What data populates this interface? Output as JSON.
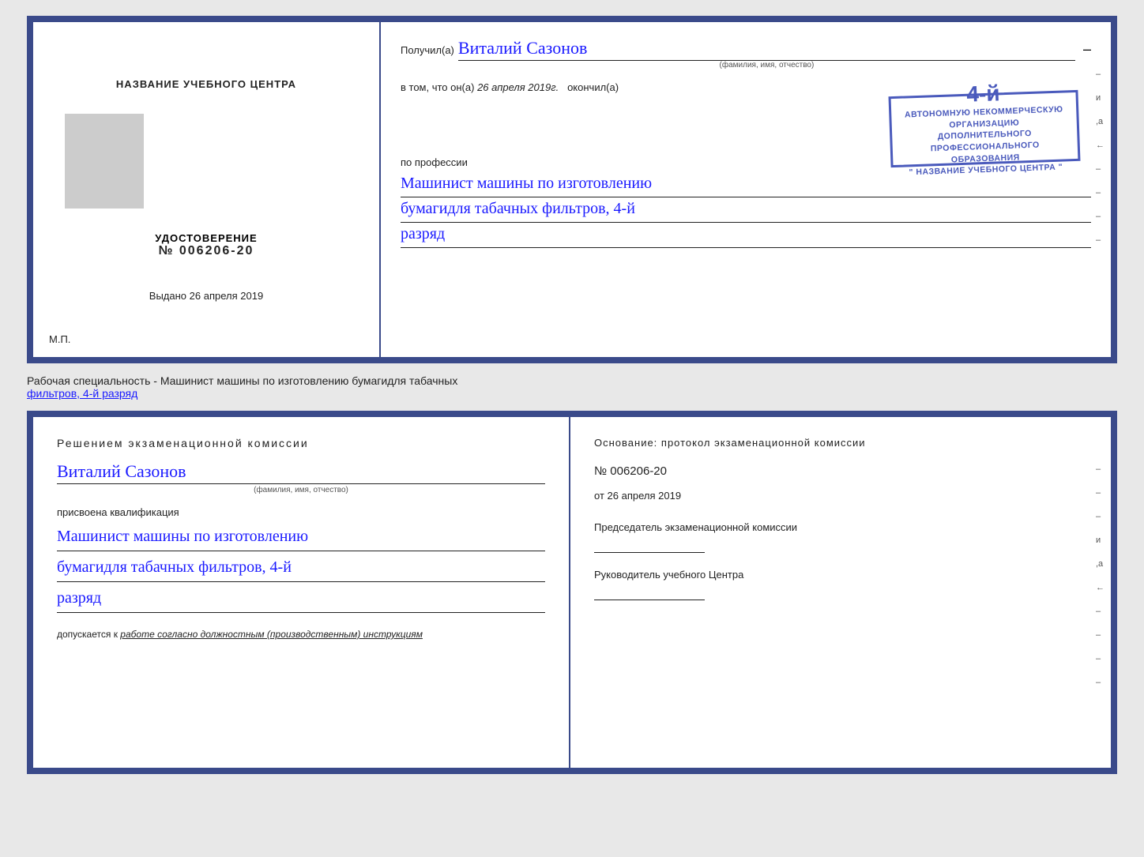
{
  "topCert": {
    "leftTitle": "НАЗВАНИЕ УЧЕБНОГО ЦЕНТРА",
    "certLabel": "УДОСТОВЕРЕНИЕ",
    "certNumber": "№ 006206-20",
    "issuedLabel": "Выдано",
    "issuedDate": "26 апреля 2019",
    "mpLabel": "М.П.",
    "recipientLabel": "Получил(а)",
    "recipientName": "Виталий Сазонов",
    "fioLabel": "(фамилия, имя, отчество)",
    "bodyText1": "в том, что он(а)",
    "dateText": "26 апреля 2019г.",
    "finishedLabel": "окончил(а)",
    "stampBigNum": "4-й",
    "stampLine1": "АВТОНОМНУЮ НЕКОММЕРЧЕСКУЮ ОРГАНИЗАЦИЮ",
    "stampLine2": "ДОПОЛНИТЕЛЬНОГО ПРОФЕССИОНАЛЬНОГО ОБРАЗОВАНИЯ",
    "stampLine3": "\" НАЗВАНИЕ УЧЕБНОГО ЦЕНТРА \"",
    "professionLabel": "по профессии",
    "professionLine1": "Машинист машины по изготовлению",
    "professionLine2": "бумагидля табачных фильтров, 4-й",
    "professionLine3": "разряд",
    "sideMarks": [
      "–",
      "и",
      ",а",
      "←",
      "–",
      "–",
      "–",
      "–"
    ]
  },
  "subtitleText": "Рабочая специальность - Машинист машины по изготовлению бумагидля табачных",
  "subtitleUnderline": "фильтров, 4-й разряд",
  "bottomCert": {
    "decisionTitle": "Решением  экзаменационной  комиссии",
    "personName": "Виталий Сазонов",
    "fioLabel": "(фамилия, имя, отчество)",
    "assignedText": "присвоена квалификация",
    "qualLine1": "Машинист машины по изготовлению",
    "qualLine2": "бумагидля табачных фильтров, 4-й",
    "qualLine3": "разряд",
    "allowedText": "допускается к",
    "allowedValue": "работе согласно должностным (производственным) инструкциям",
    "basisLabel": "Основание: протокол  экзаменационной  комиссии",
    "protocolNum": "№  006206-20",
    "dateFrom": "от",
    "dateFromValue": "26 апреля 2019",
    "chairmanLabel": "Председатель экзаменационной комиссии",
    "headLabel": "Руководитель учебного Центра",
    "sideMarks": [
      "–",
      "–",
      "–",
      "и",
      ",а",
      "←",
      "–",
      "–",
      "–",
      "–"
    ]
  }
}
